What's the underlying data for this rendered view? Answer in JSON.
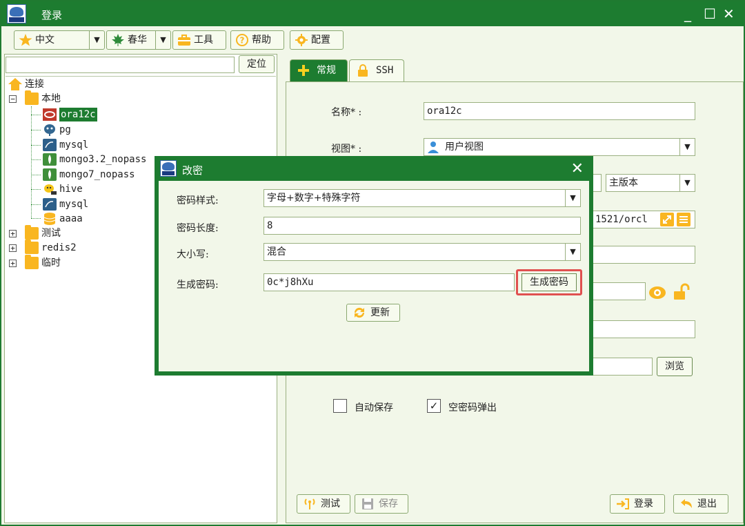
{
  "window": {
    "title": "登录",
    "minimize": "_",
    "maximize": "☐",
    "close": "✕"
  },
  "toolbar": {
    "language": "中文",
    "theme": "春华",
    "tools": "工具",
    "help": "帮助",
    "config": "配置"
  },
  "tree": {
    "locate_button": "定位",
    "search_value": "",
    "root": "连接",
    "nodes": [
      {
        "label": "本地",
        "type": "folder",
        "expanded": true
      },
      {
        "label": "ora12c",
        "type": "oracle",
        "selected": true
      },
      {
        "label": "pg",
        "type": "postgres"
      },
      {
        "label": "mysql",
        "type": "mysql"
      },
      {
        "label": "mongo3.2_nopass",
        "type": "mongodb"
      },
      {
        "label": "mongo7_nopass",
        "type": "mongodb"
      },
      {
        "label": "hive",
        "type": "hive"
      },
      {
        "label": "mysql",
        "type": "mysql"
      },
      {
        "label": "aaaa",
        "type": "database"
      },
      {
        "label": "测试",
        "type": "folder",
        "expanded": false
      },
      {
        "label": "redis2",
        "type": "folder",
        "expanded": false
      },
      {
        "label": "临时",
        "type": "folder",
        "expanded": false
      }
    ]
  },
  "tabs": [
    {
      "label": "常规",
      "active": true
    },
    {
      "label": "SSH",
      "active": false
    }
  ],
  "form": {
    "name_label": "名称* :",
    "name_value": "ora12c",
    "view_label": "视图* :",
    "view_value": "用户视图",
    "version_value": "主版本",
    "url_partial": "1521/orcl",
    "browse_button": "浏览",
    "autosave_label": "自动保存",
    "autosave_checked": false,
    "empty_pwd_popup_label": "空密码弹出",
    "empty_pwd_popup_checked": true,
    "test_button": "测试",
    "save_button": "保存",
    "login_button": "登录",
    "exit_button": "退出"
  },
  "dialog": {
    "title": "改密",
    "close": "✕",
    "style_label": "密码样式:",
    "style_value": "字母+数字+特殊字符",
    "length_label": "密码长度:",
    "length_value": "8",
    "case_label": "大小写:",
    "case_value": "混合",
    "generated_label": "生成密码:",
    "generated_value": "0c*j8hXu",
    "generate_button": "生成密码",
    "refresh_button": "更新"
  },
  "colors": {
    "primary": "#1d7c30",
    "highlight": "#e05050",
    "folder": "#f9b620"
  }
}
